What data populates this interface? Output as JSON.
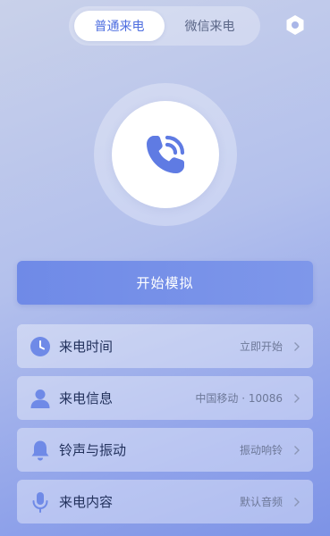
{
  "tabs": [
    {
      "label": "普通来电",
      "active": true
    },
    {
      "label": "微信来电",
      "active": false
    }
  ],
  "icons": {
    "settings": "hexagon-settings-icon",
    "call": "phone-call-icon"
  },
  "start_button": {
    "label": "开始模拟"
  },
  "settings_rows": [
    {
      "icon": "clock-icon",
      "label": "来电时间",
      "value": "立即开始"
    },
    {
      "icon": "person-icon",
      "label": "来电信息",
      "value": "中国移动 · 10086"
    },
    {
      "icon": "bell-icon",
      "label": "铃声与振动",
      "value": "振动响铃"
    },
    {
      "icon": "microphone-icon",
      "label": "来电内容",
      "value": "默认音频"
    }
  ],
  "colors": {
    "accent": "#4f6fe0",
    "icon": "#6f8ae7",
    "button": "#7189e7"
  }
}
